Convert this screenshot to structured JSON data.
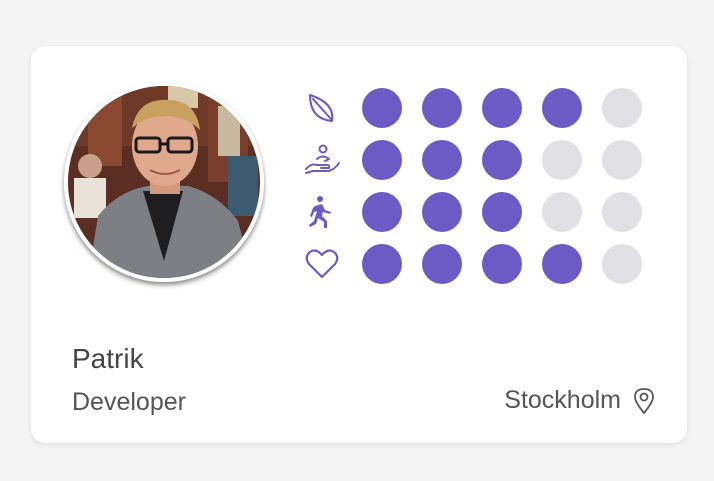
{
  "profile": {
    "name": "Patrik",
    "role": "Developer",
    "location": "Stockholm"
  },
  "colors": {
    "accent": "#6c5bc4",
    "empty_dot": "#e0e0e5",
    "card": "#ffffff",
    "background": "#f4f4f4"
  },
  "traits": [
    {
      "icon": "leaf-icon",
      "level": 4,
      "max": 5
    },
    {
      "icon": "hand-giving-icon",
      "level": 3,
      "max": 5
    },
    {
      "icon": "running-person-icon",
      "level": 3,
      "max": 5
    },
    {
      "icon": "heart-icon",
      "level": 4,
      "max": 5
    }
  ],
  "icons": {
    "location": "map-pin-icon"
  }
}
